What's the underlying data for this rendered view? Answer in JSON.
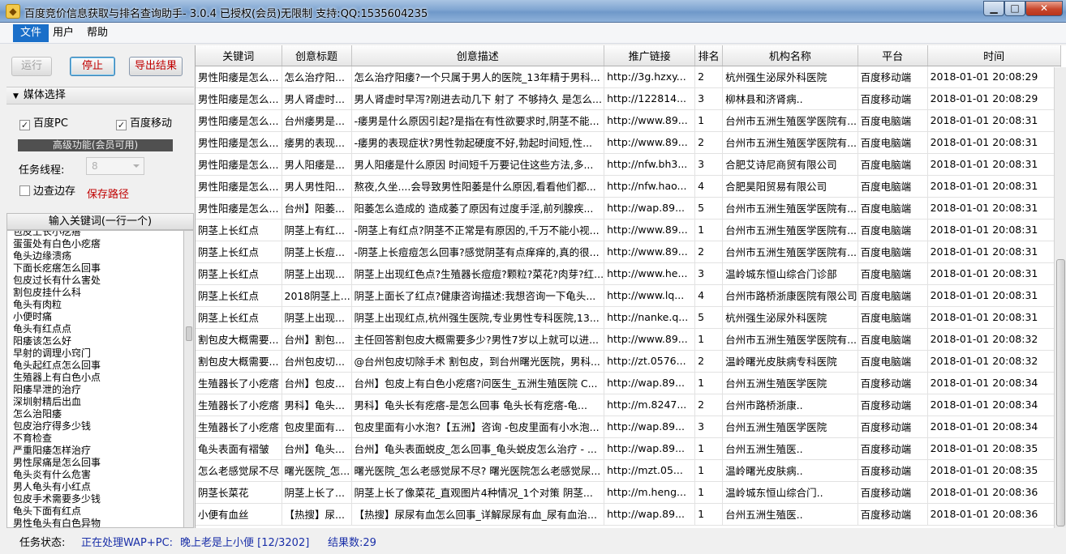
{
  "window": {
    "title": "百度竞价信息获取与排名查询助手- 3.0.4 已授权(会员)无限制    支持:QQ:1535604235",
    "minimize": "▁",
    "maximize": "□",
    "close": "✕"
  },
  "menu": [
    "文件",
    "用户",
    "帮助"
  ],
  "toolbar": {
    "run": "运行",
    "stop": "停止",
    "export": "导出结果"
  },
  "media": {
    "header": "媒体选择",
    "baidu_pc": "百度PC",
    "baidu_mobile": "百度移动",
    "advanced": "高级功能(会员可用)",
    "threads_label": "任务线程:",
    "threads_value": "8",
    "edge_check": "边查边存",
    "save_path": "保存路径"
  },
  "keywords": {
    "header": "输入关键词(一行一个)",
    "items": [
      "包皮上长小疙瘩",
      "蛋蛋处有白色小疙瘩",
      "龟头边缘溃疡",
      "下面长疙瘩怎么回事",
      "包皮过长有什么害处",
      "割包皮挂什么科",
      "龟头有肉粒",
      "小便时痛",
      "龟头有红点点",
      "阳痿该怎么好",
      "早射的调理小窍门",
      "龟头起红点怎么回事",
      "生殖器上有白色小点",
      "阳痿早泄的治疗",
      "深圳射精后出血",
      "怎么治阳痿",
      "包皮治疗得多少钱",
      "不育检查",
      "严重阳痿怎样治疗",
      "男性尿痛是怎么回事",
      "龟头炎有什么危害",
      "男人龟头有小红点",
      "包皮手术需要多少钱",
      "龟头下面有红点",
      "男性龟头有白色异物"
    ]
  },
  "table": {
    "columns": [
      "关键词",
      "创意标题",
      "创意描述",
      "推广链接",
      "排名",
      "机构名称",
      "平台",
      "时间"
    ],
    "rows": [
      [
        "男性阳痿是怎么...",
        "怎么治疗阳...",
        "怎么治疗阳痿?一个只属于男人的医院_13年精于男科...",
        "http://3g.hzxy...",
        "2",
        "杭州强生泌尿外科医院",
        "百度移动端",
        "2018-01-01 20:08:29"
      ],
      [
        "男性阳痿是怎么...",
        "男人肾虚时...",
        "男人肾虚时早泻?刚进去动几下 射了 不够持久 是怎么...",
        "http://122814...",
        "3",
        "柳林县和济肾病..",
        "百度移动端",
        "2018-01-01 20:08:29"
      ],
      [
        "男性阳痿是怎么...",
        "台州痿男是...",
        "-痿男是什么原因引起?是指在有性欲要求时,阴茎不能...",
        "http://www.89...",
        "1",
        "台州市五洲生殖医学医院有...",
        "百度电脑端",
        "2018-01-01 20:08:31"
      ],
      [
        "男性阳痿是怎么...",
        "痿男的表现...",
        "-痿男的表现症状?男性勃起硬度不好,勃起时间短,性...",
        "http://www.89...",
        "2",
        "台州市五洲生殖医学医院有...",
        "百度电脑端",
        "2018-01-01 20:08:31"
      ],
      [
        "男性阳痿是怎么...",
        "男人阳痿是...",
        "男人阳痿是什么原因 时间短千万要记住这些方法,多...",
        "http://nfw.bh3...",
        "3",
        "合肥艾诗尼商贸有限公司",
        "百度电脑端",
        "2018-01-01 20:08:31"
      ],
      [
        "男性阳痿是怎么...",
        "男人男性阳...",
        "熬夜,久坐....会导致男性阳萎是什么原因,看看他们都...",
        "http://nfw.hao...",
        "4",
        "合肥昊阳贸易有限公司",
        "百度电脑端",
        "2018-01-01 20:08:31"
      ],
      [
        "男性阳痿是怎么...",
        "台州】阳萎...",
        "阳萎怎么造成的 造成萎了原因有过度手淫,前列腺疾...",
        "http://wap.89...",
        "5",
        "台州市五洲生殖医学医院有...",
        "百度电脑端",
        "2018-01-01 20:08:31"
      ],
      [
        "阴茎上长红点",
        "阴茎上有红...",
        "-阴茎上有红点?阴茎不正常是有原因的,千万不能小视...",
        "http://www.89...",
        "1",
        "台州市五洲生殖医学医院有...",
        "百度电脑端",
        "2018-01-01 20:08:31"
      ],
      [
        "阴茎上长红点",
        "阴茎上长痘...",
        "-阴茎上长痘痘怎么回事?感觉阴茎有点痒痒的,真的很...",
        "http://www.89...",
        "2",
        "台州市五洲生殖医学医院有...",
        "百度电脑端",
        "2018-01-01 20:08:31"
      ],
      [
        "阴茎上长红点",
        "阴茎上出现...",
        "阴茎上出现红色点?生殖器长痘痘?颗粒?菜花?肉芽?红...",
        "http://www.he...",
        "3",
        "温岭城东恒山综合门诊部",
        "百度电脑端",
        "2018-01-01 20:08:31"
      ],
      [
        "阴茎上长红点",
        "2018阴茎上...",
        "阴茎上面长了红点?健康咨询描述:我想咨询一下龟头...",
        "http://www.lq...",
        "4",
        "台州市路桥浙康医院有限公司",
        "百度电脑端",
        "2018-01-01 20:08:31"
      ],
      [
        "阴茎上长红点",
        "阴茎上出现...",
        "阴茎上出现红点,杭州强生医院,专业男性专科医院,13...",
        "http://nanke.q...",
        "5",
        "杭州强生泌尿外科医院",
        "百度电脑端",
        "2018-01-01 20:08:31"
      ],
      [
        "割包皮大概需要...",
        "台州】割包...",
        "主任回答割包皮大概需要多少?男性7岁以上就可以进...",
        "http://www.89...",
        "1",
        "台州市五洲生殖医学医院有...",
        "百度电脑端",
        "2018-01-01 20:08:32"
      ],
      [
        "割包皮大概需要...",
        "台州包皮切...",
        "@台州包皮切除手术 割包皮，到台州曙光医院，男科...",
        "http://zt.0576...",
        "2",
        "温岭曙光皮肤病专科医院",
        "百度电脑端",
        "2018-01-01 20:08:32"
      ],
      [
        "生殖器长了小疙瘩",
        "台州】包皮...",
        "台州】包皮上有白色小疙瘩?问医生_五洲生殖医院 C...",
        "http://wap.89...",
        "1",
        "台州五洲生殖医学医院",
        "百度移动端",
        "2018-01-01 20:08:34"
      ],
      [
        "生殖器长了小疙瘩",
        "男科】龟头...",
        "男科】龟头长有疙瘩-是怎么回事 龟头长有疙瘩-龟...",
        "http://m.8247...",
        "2",
        "台州市路桥浙康..",
        "百度移动端",
        "2018-01-01 20:08:34"
      ],
      [
        "生殖器长了小疙瘩",
        "包皮里面有...",
        "包皮里面有小水泡?【五洲】咨询 -包皮里面有小水泡...",
        "http://wap.89...",
        "3",
        "台州五洲生殖医学医院",
        "百度移动端",
        "2018-01-01 20:08:34"
      ],
      [
        "龟头表面有褶皱",
        "台州】龟头...",
        "台州】龟头表面蜕皮_怎么回事_龟头蜕皮怎么治疗 - ...",
        "http://wap.89...",
        "1",
        "台州五洲生殖医..",
        "百度移动端",
        "2018-01-01 20:08:35"
      ],
      [
        "怎么老感觉尿不尽",
        "曙光医院_怎...",
        "曙光医院_怎么老感觉尿不尽? 曙光医院怎么老感觉尿...",
        "http://mzt.05...",
        "1",
        "温岭曙光皮肤病..",
        "百度移动端",
        "2018-01-01 20:08:35"
      ],
      [
        "阴茎长菜花",
        "阴茎上长了...",
        "阴茎上长了像菜花_直观图片4种情况_1个对策 阴茎...",
        "http://m.heng...",
        "1",
        "温岭城东恒山综合门..",
        "百度移动端",
        "2018-01-01 20:08:36"
      ],
      [
        "小便有血丝",
        "【热搜】尿...",
        "【热搜】尿尿有血怎么回事_详解尿尿有血_尿有血治...",
        "http://wap.89...",
        "1",
        "台州五洲生殖医..",
        "百度移动端",
        "2018-01-01 20:08:36"
      ]
    ]
  },
  "status": {
    "label": "任务状态:",
    "processing": "正在处理WAP+PC:",
    "current": "晚上老是上小便  [12/3202]",
    "results": "结果数:29"
  }
}
